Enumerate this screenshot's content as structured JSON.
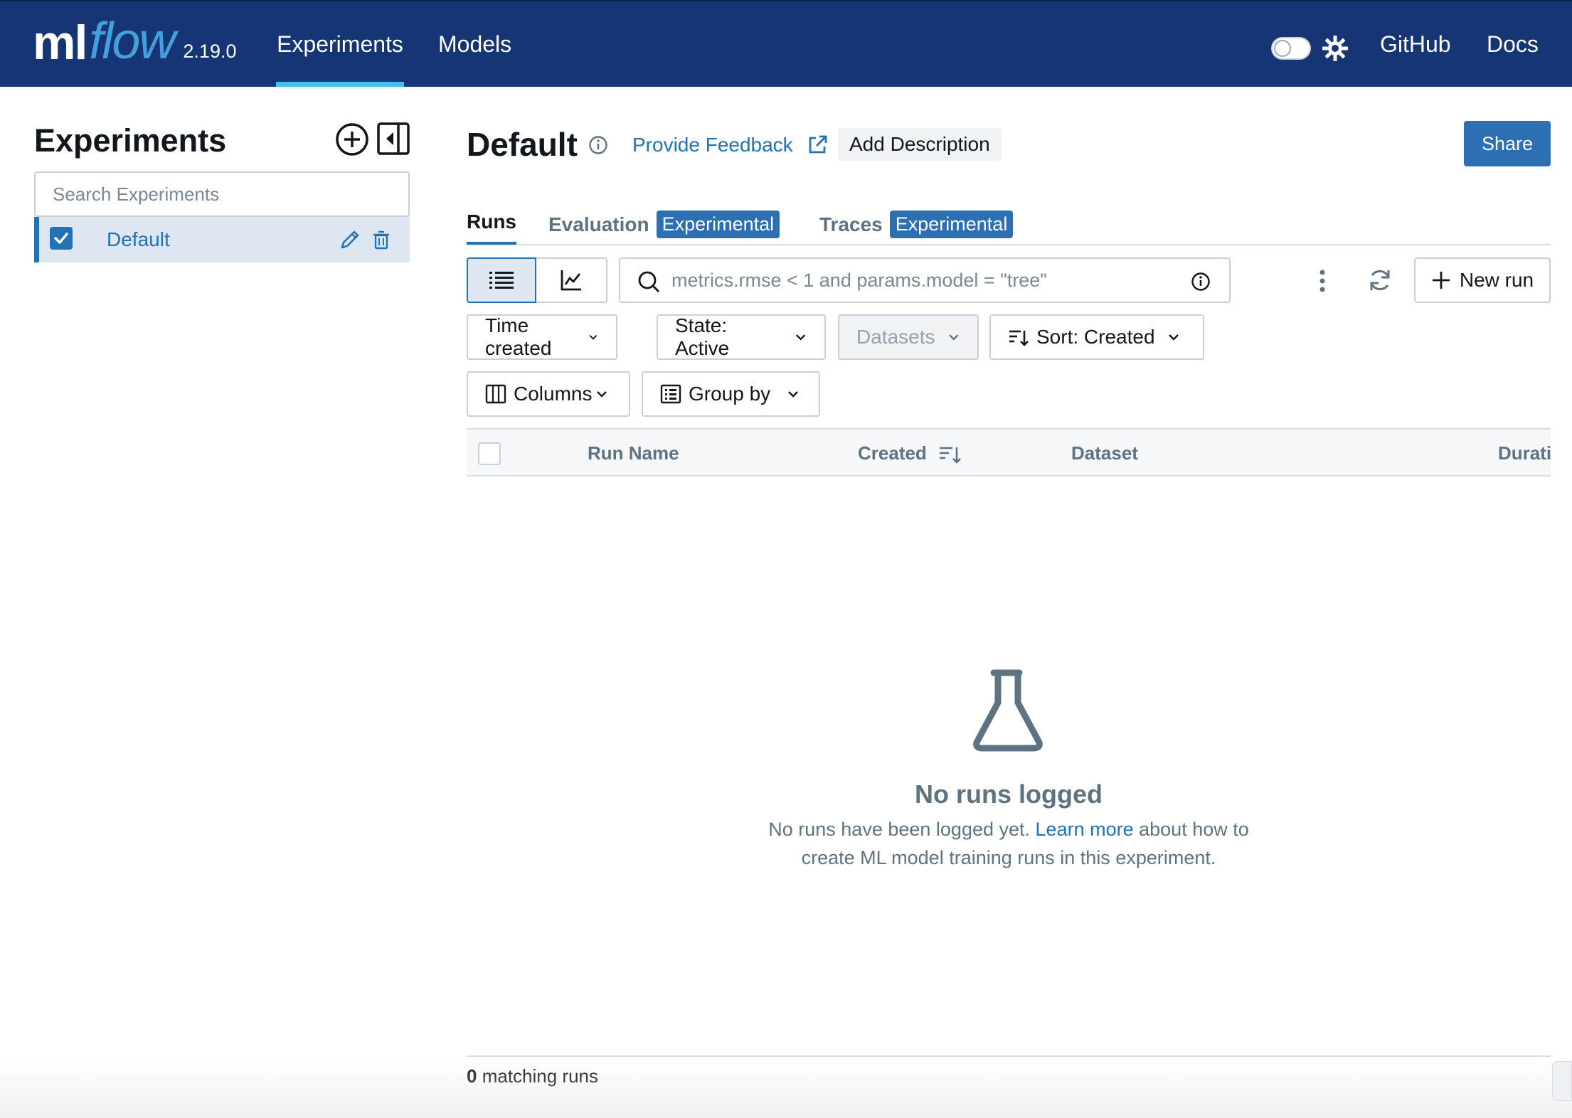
{
  "topbar": {
    "logo_ml": "ml",
    "logo_flow": "flow",
    "version": "2.19.0",
    "nav": {
      "experiments": "Experiments",
      "models": "Models",
      "github": "GitHub",
      "docs": "Docs"
    },
    "colors": {
      "bg": "#163574",
      "active_underline": "#43c0f0",
      "logo_accent": "#43a0dc"
    },
    "icons": [
      "theme-toggle",
      "gear-icon"
    ]
  },
  "sidebar": {
    "title": "Experiments",
    "search_placeholder": "Search Experiments",
    "items": [
      {
        "label": "Default",
        "checked": true
      }
    ],
    "icons": [
      "add-circle-icon",
      "collapse-sidebar-icon",
      "pencil-icon",
      "trash-icon"
    ]
  },
  "header": {
    "title": "Default",
    "feedback_label": "Provide Feedback",
    "add_description_label": "Add Description",
    "share_label": "Share"
  },
  "tabs": [
    {
      "label": "Runs",
      "active": true
    },
    {
      "label": "Evaluation",
      "badge": "Experimental"
    },
    {
      "label": "Traces",
      "badge": "Experimental"
    }
  ],
  "toolbar": {
    "search_placeholder": "metrics.rmse < 1 and params.model = \"tree\"",
    "new_run_label": "New run",
    "view_mode": "list"
  },
  "filters": {
    "time_created": "Time created",
    "state": "State: Active",
    "datasets": "Datasets",
    "sort": "Sort: Created",
    "columns": "Columns",
    "group_by": "Group by"
  },
  "table": {
    "columns": [
      "Run Name",
      "Created",
      "Dataset",
      "Durati"
    ]
  },
  "empty_state": {
    "title": "No runs logged",
    "text_before": "No runs have been logged yet.",
    "link": "Learn more",
    "text_after": "about how to create ML model training runs in this experiment."
  },
  "footer": {
    "count": "0",
    "count_suffix": "matching runs"
  },
  "colors": {
    "primary": "#2272b4",
    "button": "#2c6fb3",
    "muted_text": "#5f7281",
    "border": "#c7d0d9"
  }
}
